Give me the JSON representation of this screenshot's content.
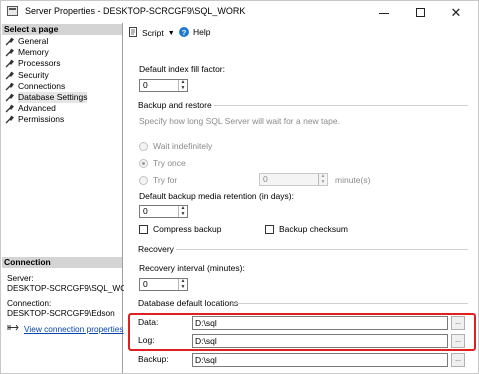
{
  "window": {
    "title": "Server Properties - DESKTOP-SCRCGF9\\SQL_WORK",
    "minimize_glyph": "",
    "maximize_glyph": "",
    "close_glyph": "✕"
  },
  "left_pane": {
    "select_header": "Select a page",
    "pages": [
      {
        "label": "General",
        "icon": "wrench-icon"
      },
      {
        "label": "Memory",
        "icon": "wrench-icon"
      },
      {
        "label": "Processors",
        "icon": "wrench-icon"
      },
      {
        "label": "Security",
        "icon": "wrench-icon"
      },
      {
        "label": "Connections",
        "icon": "wrench-icon"
      },
      {
        "label": "Database Settings",
        "icon": "wrench-icon",
        "selected": true
      },
      {
        "label": "Advanced",
        "icon": "wrench-icon"
      },
      {
        "label": "Permissions",
        "icon": "wrench-icon"
      }
    ],
    "connection_header": "Connection",
    "server_label": "Server:",
    "server_value": "DESKTOP-SCRCGF9\\SQL_WOR",
    "connection_label": "Connection:",
    "connection_value": "DESKTOP-SCRCGF9\\Edson",
    "view_link": "View connection properties"
  },
  "toolbar": {
    "script_label": "Script",
    "help_label": "Help"
  },
  "settings": {
    "fill_factor_label": "Default index fill factor:",
    "fill_factor_value": "0",
    "backup_restore_header": "Backup and restore",
    "backup_restore_desc": "Specify how long SQL Server will wait for a new tape.",
    "wait_indefinitely": "Wait indefinitely",
    "try_once": "Try once",
    "try_for": "Try for",
    "try_for_value": "0",
    "minutes_label": "minute(s)",
    "retention_label": "Default backup media retention (in days):",
    "retention_value": "0",
    "compress_backup": "Compress backup",
    "backup_checksum": "Backup checksum",
    "recovery_header": "Recovery",
    "recovery_interval_label": "Recovery interval (minutes):",
    "recovery_interval_value": "0",
    "db_locations_header": "Database default locations",
    "data_label": "Data:",
    "data_value": "D:\\sql",
    "log_label": "Log:",
    "log_value": "D:\\sql",
    "backup_label": "Backup:",
    "backup_value": "D:\\sql",
    "browse_label": "..."
  },
  "colors": {
    "highlight": "#e02020",
    "link": "#0645ad",
    "header_bg": "#d4d4d4"
  }
}
